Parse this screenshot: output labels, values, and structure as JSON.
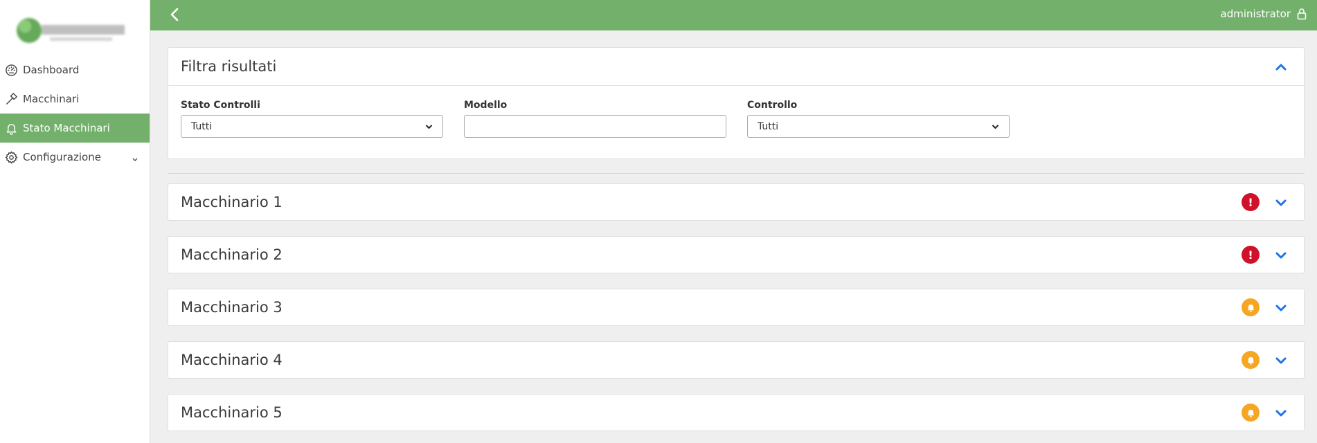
{
  "sidebar": {
    "items": [
      {
        "label": "Dashboard",
        "icon": "speedometer-icon"
      },
      {
        "label": "Macchinari",
        "icon": "hammer-icon"
      },
      {
        "label": "Stato Macchinari",
        "icon": "bell-icon",
        "active": true
      },
      {
        "label": "Configurazione",
        "icon": "gear-icon"
      }
    ]
  },
  "topbar": {
    "user": "administrator"
  },
  "filter": {
    "title": "Filtra risultati",
    "stato_label": "Stato Controlli",
    "stato_value": "Tutti",
    "modello_label": "Modello",
    "modello_value": "",
    "controllo_label": "Controllo",
    "controllo_value": "Tutti"
  },
  "machines": [
    {
      "name": "Macchinario 1",
      "status": "error"
    },
    {
      "name": "Macchinario 2",
      "status": "error"
    },
    {
      "name": "Macchinario 3",
      "status": "warning"
    },
    {
      "name": "Macchinario 4",
      "status": "warning"
    },
    {
      "name": "Macchinario 5",
      "status": "warning"
    }
  ],
  "colors": {
    "brand_green": "#73b06b",
    "accent_blue": "#1a73e8",
    "error_red": "#d0112b",
    "warning_orange": "#f5a623"
  }
}
